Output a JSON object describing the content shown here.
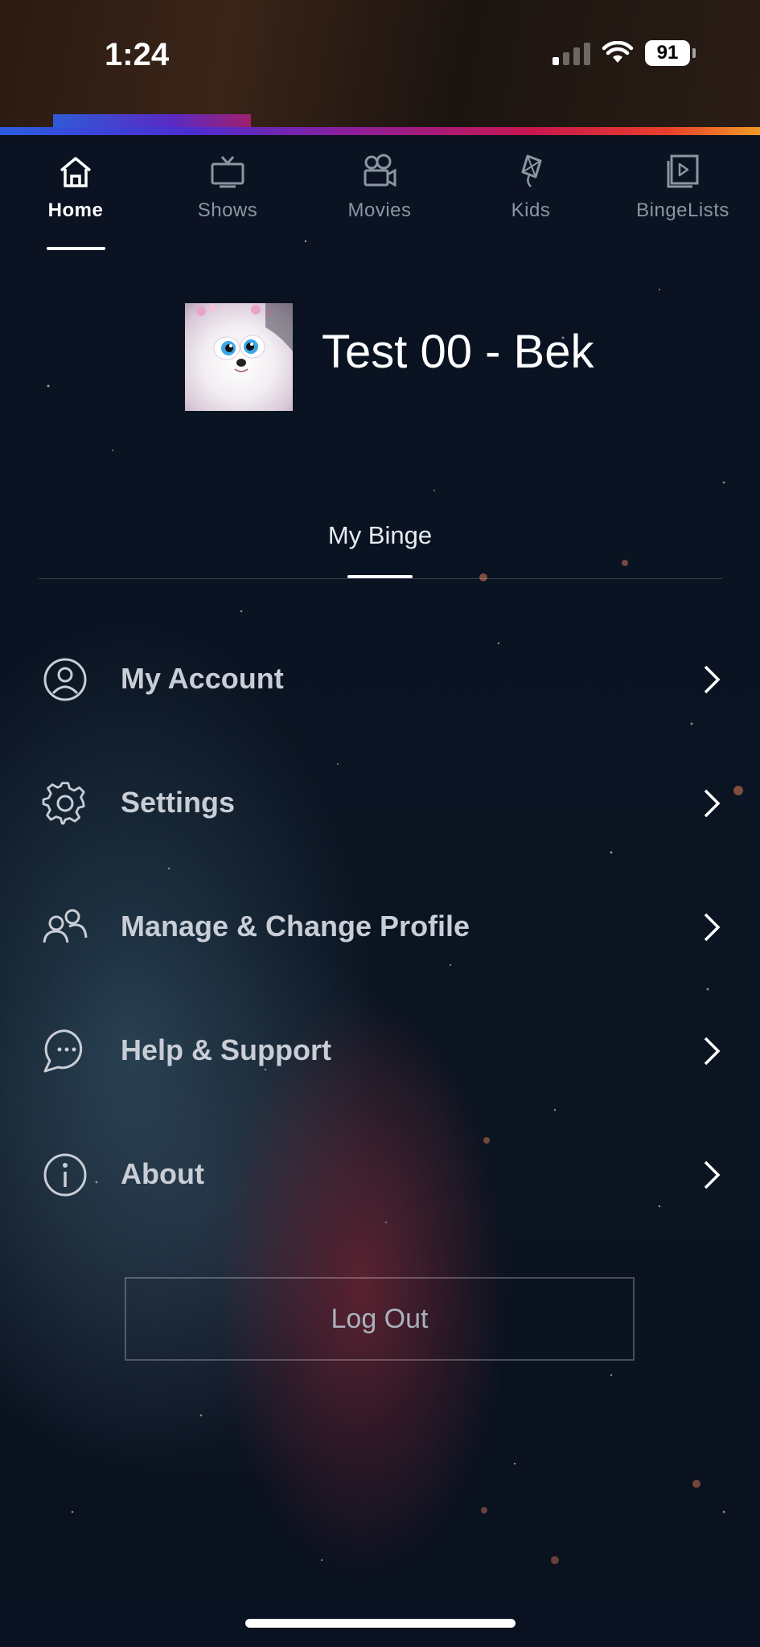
{
  "status_bar": {
    "time": "1:24",
    "battery": "91"
  },
  "nav": {
    "items": [
      {
        "label": "Home",
        "icon": "home-icon",
        "active": true
      },
      {
        "label": "Shows",
        "icon": "tv-icon",
        "active": false
      },
      {
        "label": "Movies",
        "icon": "movie-camera-icon",
        "active": false
      },
      {
        "label": "Kids",
        "icon": "kite-icon",
        "active": false
      },
      {
        "label": "BingeLists",
        "icon": "binge-list-icon",
        "active": false
      }
    ]
  },
  "profile": {
    "name": "Test 00 - Bek"
  },
  "tabs": {
    "active": "My Binge"
  },
  "menu": {
    "items": [
      {
        "label": "My Account",
        "icon": "account-icon"
      },
      {
        "label": "Settings",
        "icon": "gear-icon"
      },
      {
        "label": "Manage & Change Profile",
        "icon": "profiles-icon"
      },
      {
        "label": "Help & Support",
        "icon": "chat-bubble-icon"
      },
      {
        "label": "About",
        "icon": "info-icon"
      }
    ]
  },
  "logout": {
    "label": "Log Out"
  },
  "colors": {
    "background": "#0a1120",
    "menu_text": "#c8cdd6",
    "nav_inactive": "#8c95a3"
  }
}
